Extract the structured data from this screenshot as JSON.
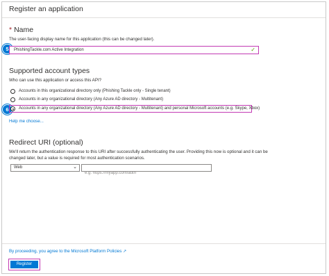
{
  "header": {
    "title": "Register an application"
  },
  "name_section": {
    "required_marker": "*",
    "title": "Name",
    "description": "The user-facing display name for this application (this can be changed later).",
    "input_value": "PhishingTackle.com Active Integration",
    "check_symbol": "✓",
    "step_number": "5"
  },
  "account_types": {
    "title": "Supported account types",
    "question": "Who can use this application or access this API?",
    "options": [
      {
        "label": "Accounts in this organizational directory only (Phishing Tackle only - Single tenant)",
        "selected": false
      },
      {
        "label": "Accounts in any organizational directory (Any Azure AD directory - Multitenant)",
        "selected": false
      },
      {
        "label": "Accounts in any organizational directory (Any Azure AD directory - Multitenant) and personal Microsoft accounts (e.g. Skype, Xbox)",
        "selected": true
      }
    ],
    "step_number": "6",
    "help_link": "Help me choose..."
  },
  "redirect": {
    "title": "Redirect URI (optional)",
    "description_line1": "We'll return the authentication response to this URI after successfully authenticating the user. Providing this now is optional and it can be",
    "description_line2": "changed later, but a value is required for most authentication scenarios.",
    "platform_value": "Web",
    "uri_placeholder": "e.g. https://myapp.com/auth"
  },
  "footer": {
    "policy_text": "By proceeding, you agree to the Microsoft Platform Policies",
    "register_label": "Register"
  },
  "colors": {
    "accent": "#0078d4",
    "highlight_border": "#c239b3",
    "valid_check": "#57a300"
  },
  "icons": {
    "check": "check-icon",
    "chevron": "chevron-down-icon",
    "external_link": "external-link-icon"
  }
}
